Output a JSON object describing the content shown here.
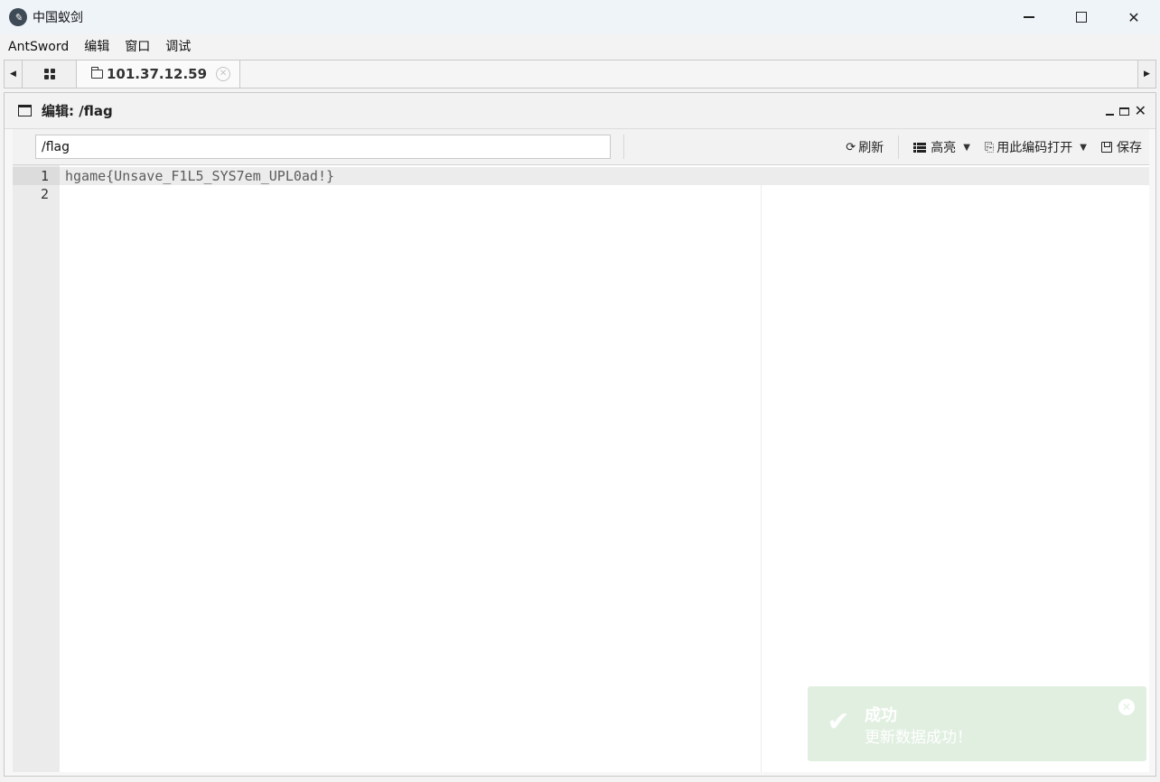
{
  "window": {
    "title": "中国蚁剑",
    "app_icon": "antsword-logo-icon",
    "controls": [
      "minimize-icon",
      "maximize-icon",
      "close-icon"
    ],
    "close_glyph": "✕"
  },
  "menu": {
    "items": [
      "AntSword",
      "编辑",
      "窗口",
      "调试"
    ]
  },
  "tabs": {
    "home_icon": "grid-icon",
    "active": {
      "icon": "folder-icon",
      "label": "101.37.12.59",
      "close_glyph": "✕"
    },
    "left_arrow": "◀",
    "right_arrow": "▶"
  },
  "editor": {
    "title": "编辑: /flag",
    "path_value": "/flag",
    "toolbar": {
      "refresh_label": "刷新",
      "highlight_label": "高亮",
      "encoding_label": "用此编码打开",
      "save_label": "保存",
      "refresh_glyph": "⟳",
      "encoding_glyph": "⎘",
      "caret_glyph": "▼"
    },
    "lines": [
      {
        "number": "1",
        "text": "hgame{Unsave_F1L5_SYS7em_UPL0ad!}"
      },
      {
        "number": "2",
        "text": ""
      }
    ],
    "close_glyph": "✕"
  },
  "toast": {
    "title": "成功",
    "message": "更新数据成功！",
    "check_glyph": "✔",
    "close_glyph": "✕",
    "color": "#e1efe1"
  }
}
